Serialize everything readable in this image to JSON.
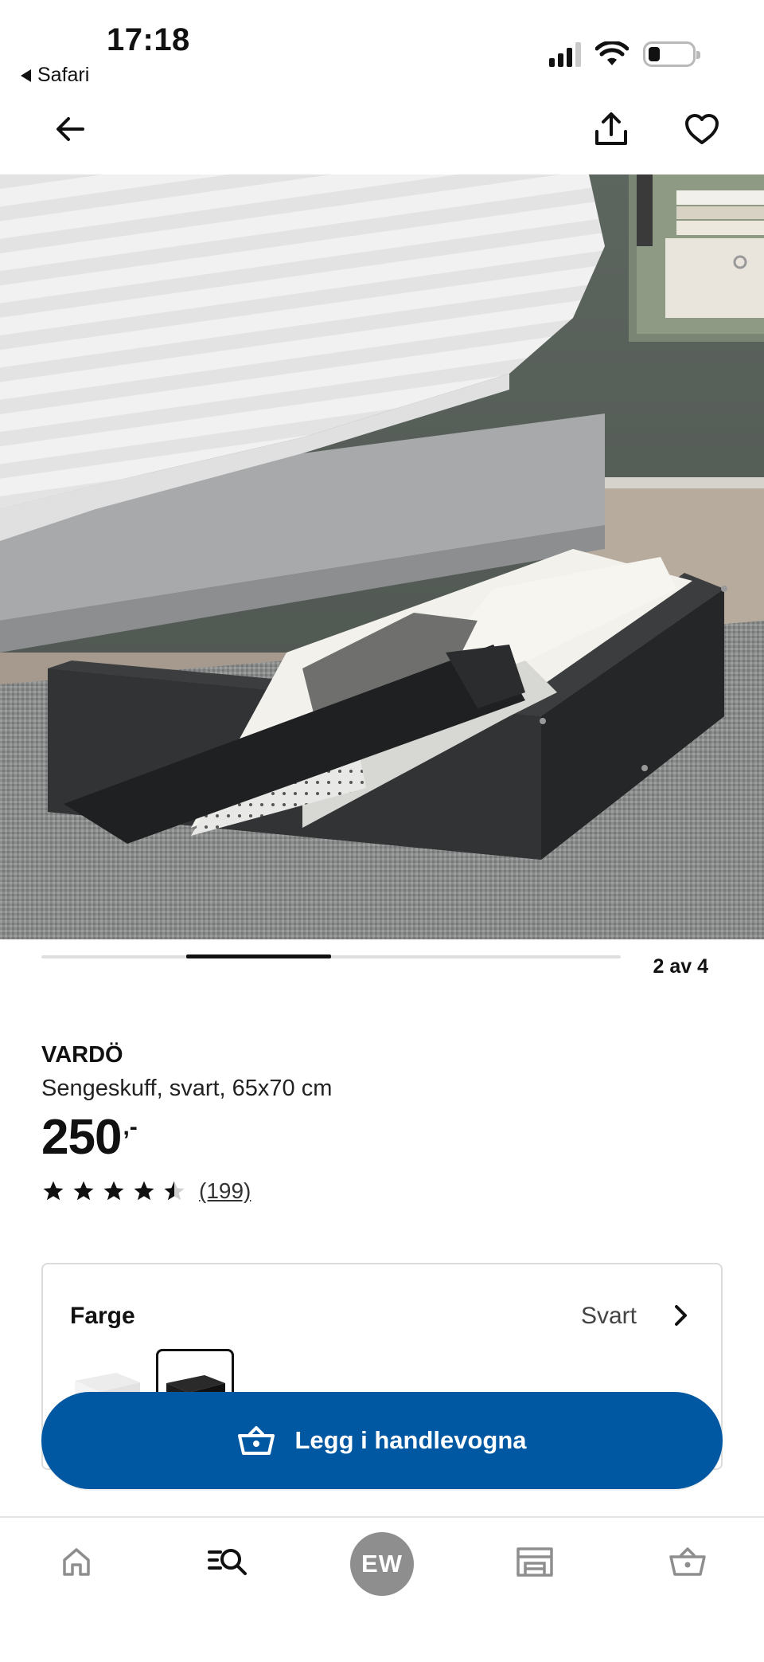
{
  "status_bar": {
    "time": "17:18",
    "back_app": "Safari",
    "icons": [
      "cellular-signal-icon",
      "wifi-icon",
      "battery-icon"
    ]
  },
  "nav": {
    "icons": [
      "back-arrow-icon",
      "share-icon",
      "favorite-heart-icon"
    ]
  },
  "gallery": {
    "counter": "2 av 4",
    "current": 2,
    "total": 4
  },
  "product": {
    "name": "VARDÖ",
    "description": "Sengeskuff, svart, 65x70 cm",
    "price": "250",
    "price_suffix": ",-",
    "rating": 4.5,
    "rating_max": 5,
    "review_count": "(199)"
  },
  "color_selector": {
    "label": "Farge",
    "value": "Svart",
    "options": [
      "white",
      "black"
    ],
    "selected": "black"
  },
  "cart_button": {
    "label": "Legg i handlevogna"
  },
  "tab_bar": {
    "avatar_initials": "EW",
    "tabs": [
      "home-icon",
      "search-browse-icon",
      "profile-avatar",
      "store-icon",
      "cart-icon"
    ]
  },
  "colors": {
    "primary_blue": "#0058a3",
    "text": "#111111",
    "avatar_grey": "#8e8e8e"
  }
}
